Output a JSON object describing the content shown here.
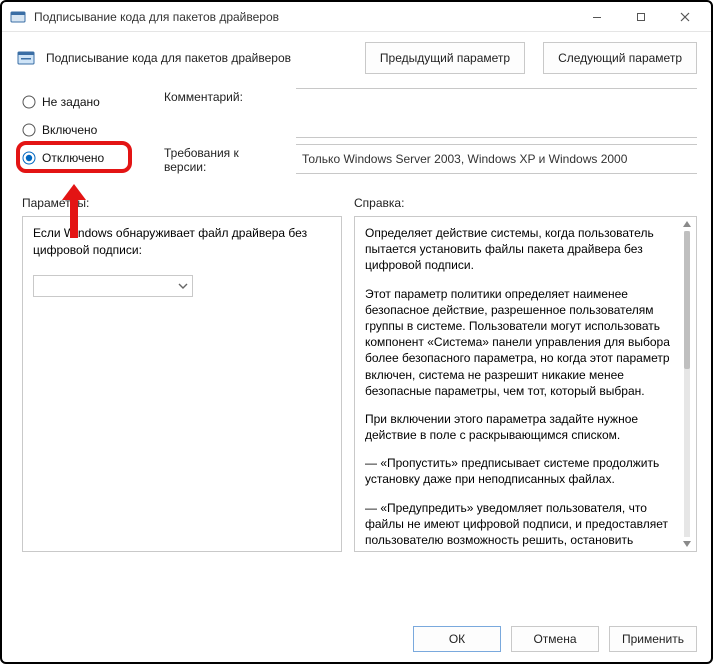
{
  "window": {
    "title": "Подписывание кода для пакетов драйверов"
  },
  "header": {
    "text": "Подписывание кода для пакетов драйверов",
    "prev": "Предыдущий параметр",
    "next": "Следующий параметр"
  },
  "state": {
    "options": {
      "not_configured": "Не задано",
      "enabled": "Включено",
      "disabled": "Отключено"
    },
    "selected": "disabled"
  },
  "meta": {
    "comment_label": "Комментарий:",
    "comment_value": "",
    "supported_label": "Требования к версии:",
    "supported_value": "Только Windows Server 2003, Windows XP и Windows 2000"
  },
  "sections": {
    "options_label": "Параметры:",
    "help_label": "Справка:"
  },
  "options_panel": {
    "text": "Если Windows обнаруживает файл драйвера без цифровой подписи:",
    "select_value": ""
  },
  "help": {
    "p1": "Определяет действие системы, когда пользователь пытается установить файлы пакета драйвера без цифровой подписи.",
    "p2": "Этот параметр политики определяет наименее безопасное действие, разрешенное пользователям группы в системе. Пользователи могут использовать компонент «Система» панели управления для выбора более безопасного параметра, но когда этот параметр включен, система не разрешит никакие менее безопасные параметры, чем тот, который выбран.",
    "p3": "При включении этого параметра задайте нужное действие в поле с раскрывающимся списком.",
    "p4": "—   «Пропустить» предписывает системе продолжить установку даже при неподписанных файлах.",
    "p5": "—   «Предупредить» уведомляет пользователя, что файлы не имеют цифровой подписи, и предоставляет пользователю возможность решить, остановить установку или продолжить, и разрешить ли установку неподписанных файлов. Параметр"
  },
  "footer": {
    "ok": "ОК",
    "cancel": "Отмена",
    "apply": "Применить"
  }
}
